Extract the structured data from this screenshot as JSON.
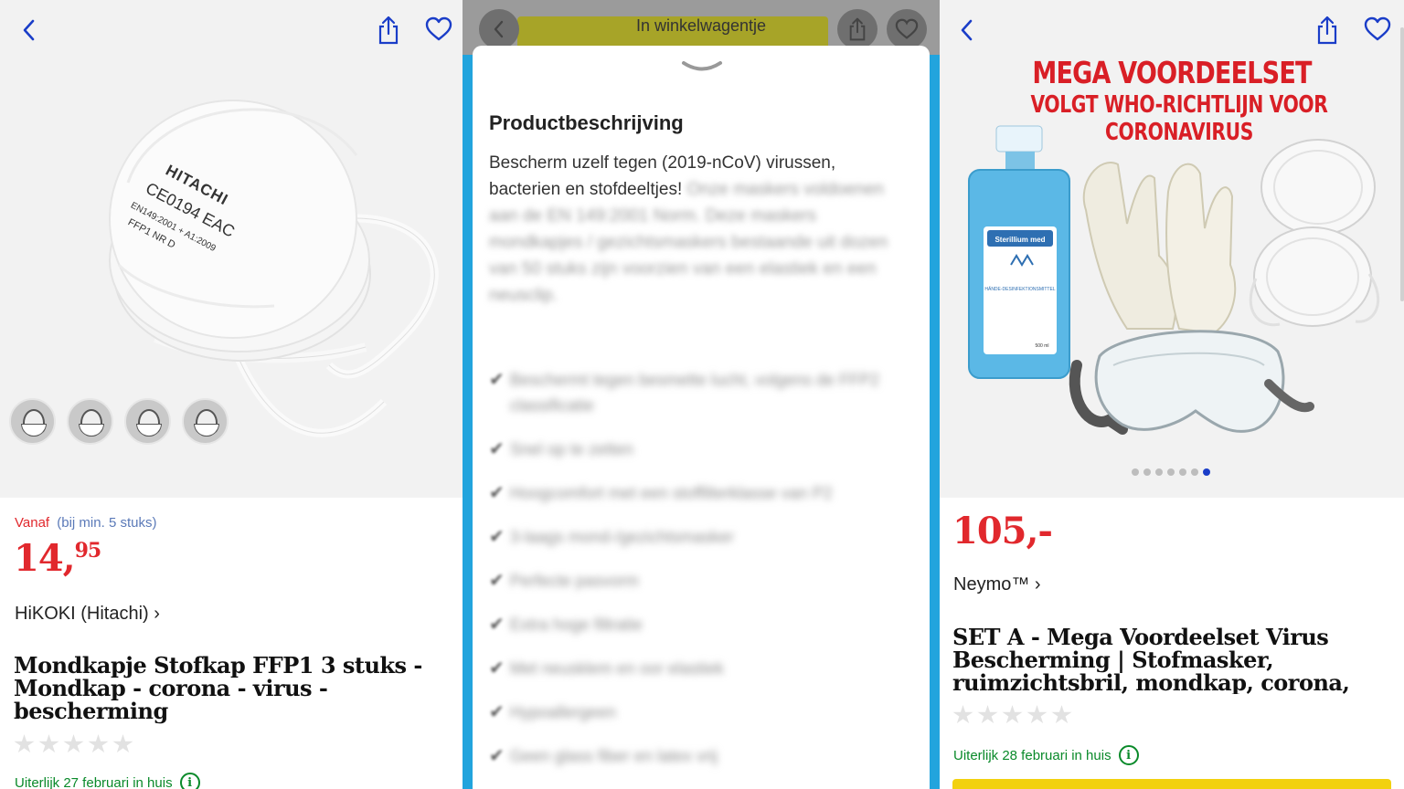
{
  "left": {
    "nav": {
      "back_icon": "chevron-left-icon",
      "share_icon": "share-icon",
      "favorite_icon": "heart-icon"
    },
    "image_text": {
      "brand": "HITACHI",
      "cert": "CE0194 EAC",
      "norm": "EN149:2001 + A1:2009",
      "class": "FFP1 NR D"
    },
    "price_prefix": "Vanaf",
    "price_note": "(bij min. 5 stuks)",
    "price_int": "14,",
    "price_dec": "95",
    "brand_link": "HiKOKI (Hitachi) ›",
    "title": "Mondkapje Stofkap FFP1 3 stuks - Mondkap - corona - virus - bescherming",
    "rating": 0,
    "delivery": "Uiterlijk 27 februari in huis"
  },
  "middle": {
    "cart_button": "In winkelwagentje",
    "sheet_title": "Productbeschrijving",
    "desc_visible": "Bescherm uzelf tegen (2019-nCoV) virussen, bacterien en stofdeeltjes!",
    "desc_blurred": "Onze maskers voldoenen aan de EN 149:2001 Norm. Deze maskers mondkapjes / gezichtsmaskers bestaande uit dozen van 50 stuks zijn voorzien van een elastiek en een neusclip.",
    "bullets": [
      "Beschermt tegen besmette lucht, volgens de FFP2 classificatie",
      "Snel op te zetten",
      "Hoogcomfort met een stoffilterklasse van P2",
      "3-laags mond-/gezichtsmasker",
      "Perfecte pasvorm",
      "Extra hoge filtratie",
      "Met neusklem en oor elastiek",
      "Hypoallergeen",
      "Geen glass fiber en latex vrij"
    ]
  },
  "right": {
    "banner_line1": "MEGA VOORDEELSET",
    "banner_line2": "VOLGT WHO-RICHTLIJN VOOR CORONAVIRUS",
    "bottle_label": "Sterillium med",
    "bottle_sub": "HÄNDE-DESINFEKTIONSMITTEL",
    "bottle_volume": "500 ml",
    "carousel_total": 7,
    "carousel_active": 7,
    "price": "105,-",
    "brand_link": "Neymo™ ›",
    "title": "SET A - Mega Voordeelset Virus Bescherming | Stofmasker, ruimzichtsbril, mondkap, corona, med",
    "rating": 0,
    "delivery": "Uiterlijk 28 februari in huis"
  },
  "colors": {
    "price_red": "#e1282d",
    "delivery_green": "#0a8a2a",
    "link_blue": "#1a3dc8",
    "divider_blue": "#22a4dd",
    "cart_yellow": "#f2d10f"
  }
}
